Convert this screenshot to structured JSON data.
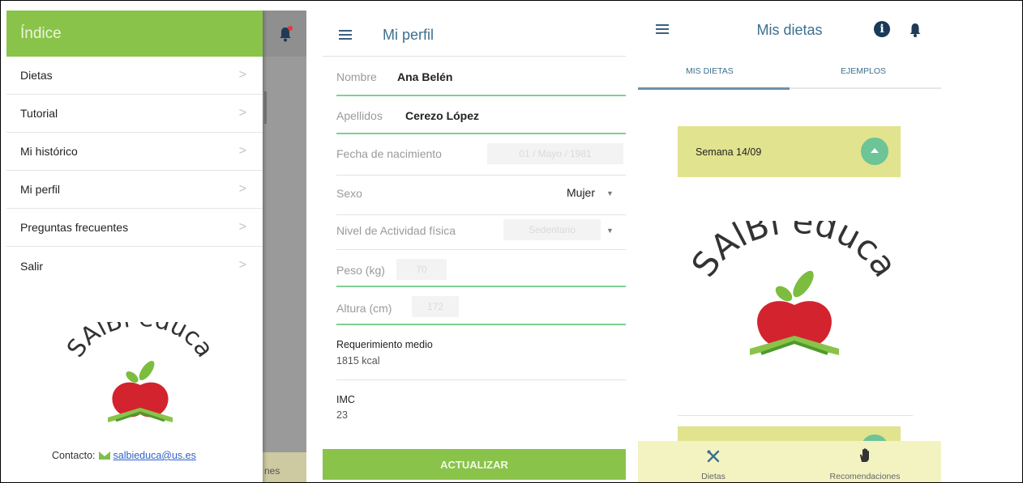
{
  "panel_menu": {
    "header_title": "Índice",
    "items": [
      {
        "label": "Dietas"
      },
      {
        "label": "Tutorial"
      },
      {
        "label": "Mi histórico"
      },
      {
        "label": "Mi perfil"
      },
      {
        "label": "Preguntas frecuentes"
      },
      {
        "label": "Salir"
      }
    ],
    "chevron": ">",
    "logo_text": "SAlBi educa",
    "contact_label": "Contacto:",
    "contact_email": "salbieduca@us.es",
    "background_tab_fragment": "nes"
  },
  "panel_profile": {
    "title": "Mi perfil",
    "fields": {
      "nombre": {
        "label": "Nombre",
        "value": "Ana Belén"
      },
      "apellidos": {
        "label": "Apellidos",
        "value": "Cerezo López"
      },
      "fecha": {
        "label": "Fecha de nacimiento",
        "value": "01 / Mayo / 1981"
      },
      "sexo": {
        "label": "Sexo",
        "value": "Mujer"
      },
      "actividad": {
        "label": "Nivel de Actividad física",
        "value": "Sedentario"
      },
      "peso": {
        "label": "Peso (kg)",
        "value": "70"
      },
      "altura": {
        "label": "Altura (cm)",
        "value": "172"
      }
    },
    "requerimiento": {
      "label": "Requerimiento medio",
      "value": "1815 kcal"
    },
    "imc": {
      "label": "IMC",
      "value": "23"
    },
    "update_button": "ACTUALIZAR"
  },
  "panel_diets": {
    "title": "Mis dietas",
    "tabs": [
      "MIS DIETAS",
      "EJEMPLOS"
    ],
    "active_tab": "MIS DIETAS",
    "week_card": "Semana 14/09",
    "logo_text": "SAlBi educa",
    "bottom_nav": [
      {
        "label": "Dietas",
        "icon": "cutlery-icon"
      },
      {
        "label": "Recomendaciones",
        "icon": "hand-icon"
      }
    ]
  },
  "colors": {
    "primary_green": "#8ac34a",
    "title_blue": "#3d6f8e",
    "field_underline": "#7fd193",
    "week_card": "#e2e38e",
    "fab": "#6cc497",
    "bottom_nav": "#f3f3c2"
  }
}
